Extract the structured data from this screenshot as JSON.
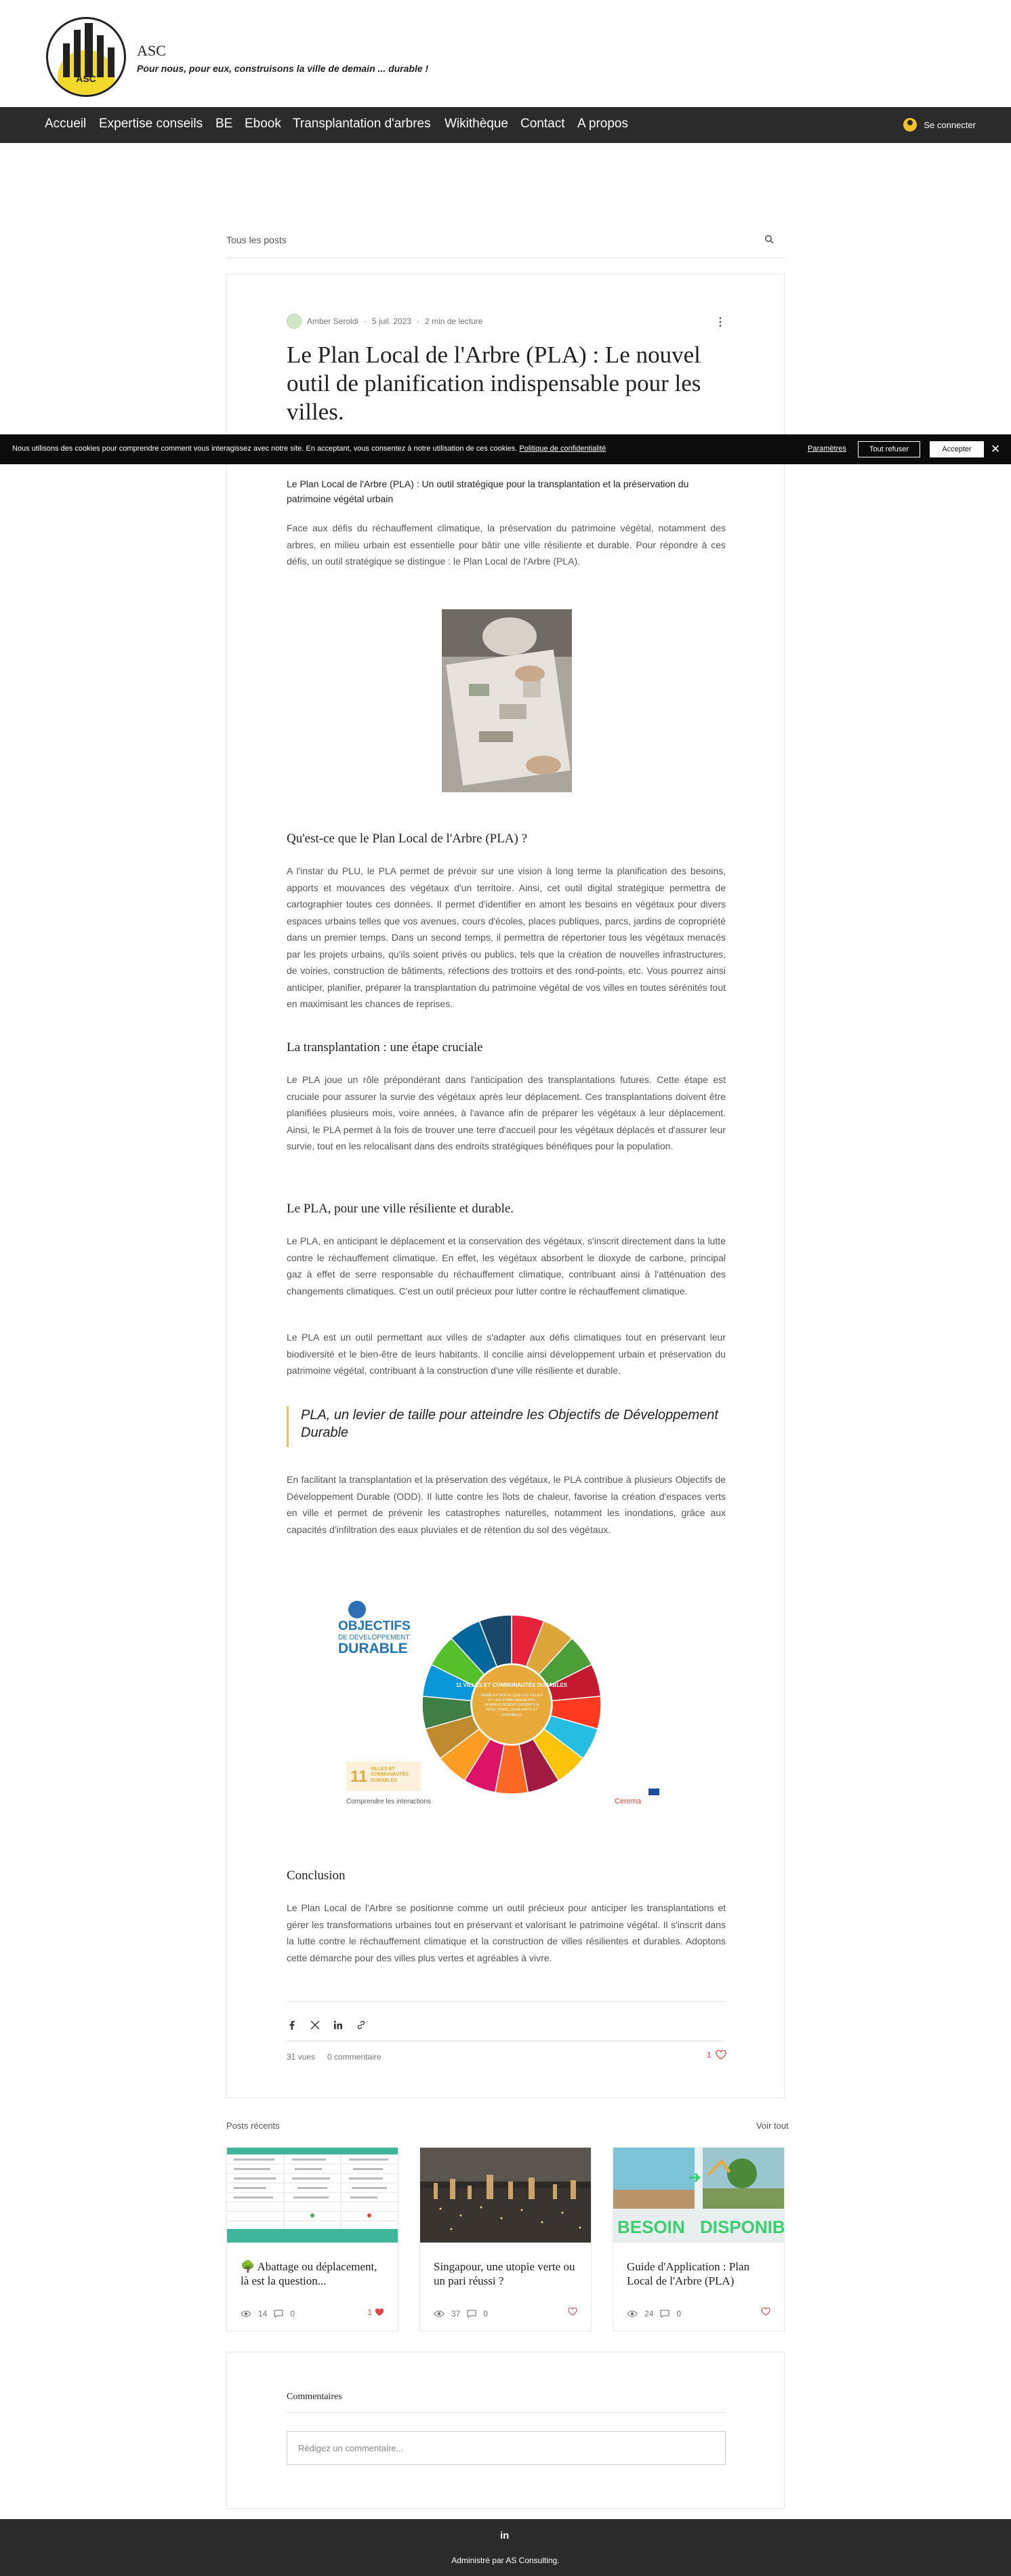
{
  "site": {
    "name": "ASC",
    "tagline": "Pour nous, pour eux, construisons la ville de demain ... durable !",
    "logo_text": "ASC"
  },
  "nav": {
    "items": [
      "Accueil",
      "Expertise conseils",
      "BE",
      "Ebook",
      "Transplantation d'arbres",
      "Wikithèque",
      "Contact",
      "A propos"
    ],
    "login": "Se connecter"
  },
  "posts_bar": {
    "all_posts": "Tous les posts"
  },
  "post": {
    "author": "Amber Seroldi",
    "date": "5 juil. 2023",
    "read_time": "2 min de lecture",
    "title": "Le Plan Local de l'Arbre (PLA) : Le nouvel outil de planification indispensable pour les villes.",
    "lead": "Le Plan Local de l'Arbre (PLA) : Un outil stratégique pour la transplantation et la préservation du patrimoine végétal urbain",
    "intro": "Face aux défis du réchauffement climatique, la préservation du patrimoine végétal, notamment des arbres, en milieu urbain est essentielle pour bâtir une ville résiliente et durable. Pour répondre à ces défis, un outil stratégique se distingue : le Plan Local de l'Arbre (PLA).",
    "h_what": "Qu'est-ce que le Plan Local de l'Arbre (PLA) ?",
    "p_what": "A l'instar du PLU, le PLA permet de prévoir sur une vision à long terme la planification des besoins, apports et mouvances des végétaux d'un territoire.  Ainsi, cet outil digital stratégique permettra de cartographier toutes ces données. Il permet d'identifier en amont les besoins en végétaux pour divers espaces urbains telles que vos avenues, cours d'écoles, places publiques, parcs, jardins de copropriété dans un premier temps. Dans un second temps, il permettra de répertorier tous les végétaux menacés par les projets urbains, qu'ils soient privés ou publics, tels que la création de nouvelles infrastructures, de voiries, construction de bâtiments, réfections des trottoirs et des rond-points, etc. Vous pourrez ainsi anticiper, planifier, préparer la transplantation du patrimoine végétal de vos villes en toutes sérénités tout en maximisant les chances de reprises.",
    "h_transplant": "La transplantation : une étape cruciale",
    "p_transplant": "Le PLA joue un rôle prépondérant dans l'anticipation des transplantations futures. Cette étape est cruciale pour assurer la survie des végétaux après leur déplacement. Ces transplantations doivent être planifiées plusieurs mois, voire années, à l'avance afin de préparer les végétaux à leur déplacement. Ainsi, le PLA permet à la fois de trouver une terre d'accueil pour les végétaux déplacés et d'assurer leur survie, tout en les relocalisant dans des endroits stratégiques bénéfiques pour la population.",
    "h_resilient": "Le PLA, pour une ville résiliente et durable.",
    "p_resilient1": "Le PLA, en anticipant le déplacement et la conservation des végétaux, s'inscrit directement dans la lutte contre le réchauffement climatique. En effet, les végétaux absorbent le dioxyde de carbone, principal gaz à effet de serre responsable du réchauffement climatique, contribuant ainsi à l'atténuation des changements climatiques. C'est un outil précieux pour lutter contre le réchauffement climatique.",
    "p_resilient2": "Le PLA est un outil permettant aux villes de s'adapter aux défis climatiques tout en préservant leur biodiversité et le bien-être de leurs habitants. Il concilie ainsi développement urbain et préservation du patrimoine végétal, contribuant à la construction d'une ville résiliente et durable.",
    "quote": "PLA, un levier de taille pour atteindre les Objectifs de Développement Durable",
    "p_odd": "En facilitant la transplantation et la préservation des végétaux, le PLA contribue à plusieurs Objectifs de Développement Durable (ODD). Il lutte contre les îlots de chaleur, favorise la création d'espaces verts en ville et permet de prévenir les catastrophes naturelles, notamment les inondations, grâce aux capacités d'infiltration des eaux pluviales et de rétention du sol des végétaux.",
    "h_conclusion": "Conclusion",
    "p_conclusion": "Le Plan Local de l'Arbre se positionne comme un outil précieux pour anticiper les transplantations et gérer les transformations urbaines tout en préservant et valorisant le patrimoine végétal. Il s'inscrit dans la lutte contre le réchauffement climatique et la construction de villes résilientes et durables. Adoptons cette démarche pour des villes plus vertes et agréables à vivre.",
    "views": "31 vues",
    "comments": "0 commentaire",
    "likes": "1"
  },
  "sdg": {
    "title1": "OBJECTIFS",
    "title2": "DE DÉVELOPPEMENT",
    "title3": "DURABLE",
    "center": "11 VILLES ET COMMUNAUTÉS DURABLES",
    "center_sub": "FAIRE EN SORTE QUE LES VILLES ET LES ÉTABLISSEMENTS HUMAINS SOIENT OUVERTS À TOUS, SÛRS, RÉSILIENTS ET DURABLES",
    "badge_num": "11",
    "badge_text": "VILLES ET COMMUNAUTÉS DURABLES",
    "caption": "Comprendre les interactions",
    "cerema": "Cerema",
    "colors": [
      "#e5243b",
      "#dda63a",
      "#4c9f38",
      "#c5192d",
      "#ff3a21",
      "#26bde2",
      "#fcc30b",
      "#a21942",
      "#fd6925",
      "#dd1367",
      "#fd9d24",
      "#bf8b2e",
      "#3f7e44",
      "#0a97d9",
      "#56c02b",
      "#00689d",
      "#19486a"
    ]
  },
  "share": {
    "icons": [
      "facebook-icon",
      "x-icon",
      "linkedin-icon",
      "link-icon"
    ]
  },
  "recent": {
    "title": "Posts récents",
    "see_all": "Voir tout",
    "posts": [
      {
        "title": "🌳 Abattage ou déplacement, là est la question...",
        "views": "14",
        "comments": "0",
        "likes": "1"
      },
      {
        "title": "Singapour, une utopie verte ou un pari réussi ?",
        "views": "37",
        "comments": "0",
        "likes": ""
      },
      {
        "title": "Guide d'Application : Plan Local de l'Arbre (PLA)",
        "views": "24",
        "comments": "0",
        "likes": ""
      }
    ],
    "thumb3_left": "BESOIN",
    "thumb3_right": "DISPONIBLE"
  },
  "comments_section": {
    "title": "Commentaires",
    "placeholder": "Rédigez un commentaire..."
  },
  "footer": {
    "social": "in",
    "text": "Administré par AS Consulting."
  },
  "cookie": {
    "text": "Nous utilisons des cookies pour comprendre comment vous interagissez avec notre site. En acceptant, vous consentez à notre utilisation de ces cookies.",
    "policy": "Politique de confidentialité",
    "settings": "Paramètres",
    "refuse": "Tout refuser",
    "accept": "Accepter",
    "close": "✕"
  }
}
